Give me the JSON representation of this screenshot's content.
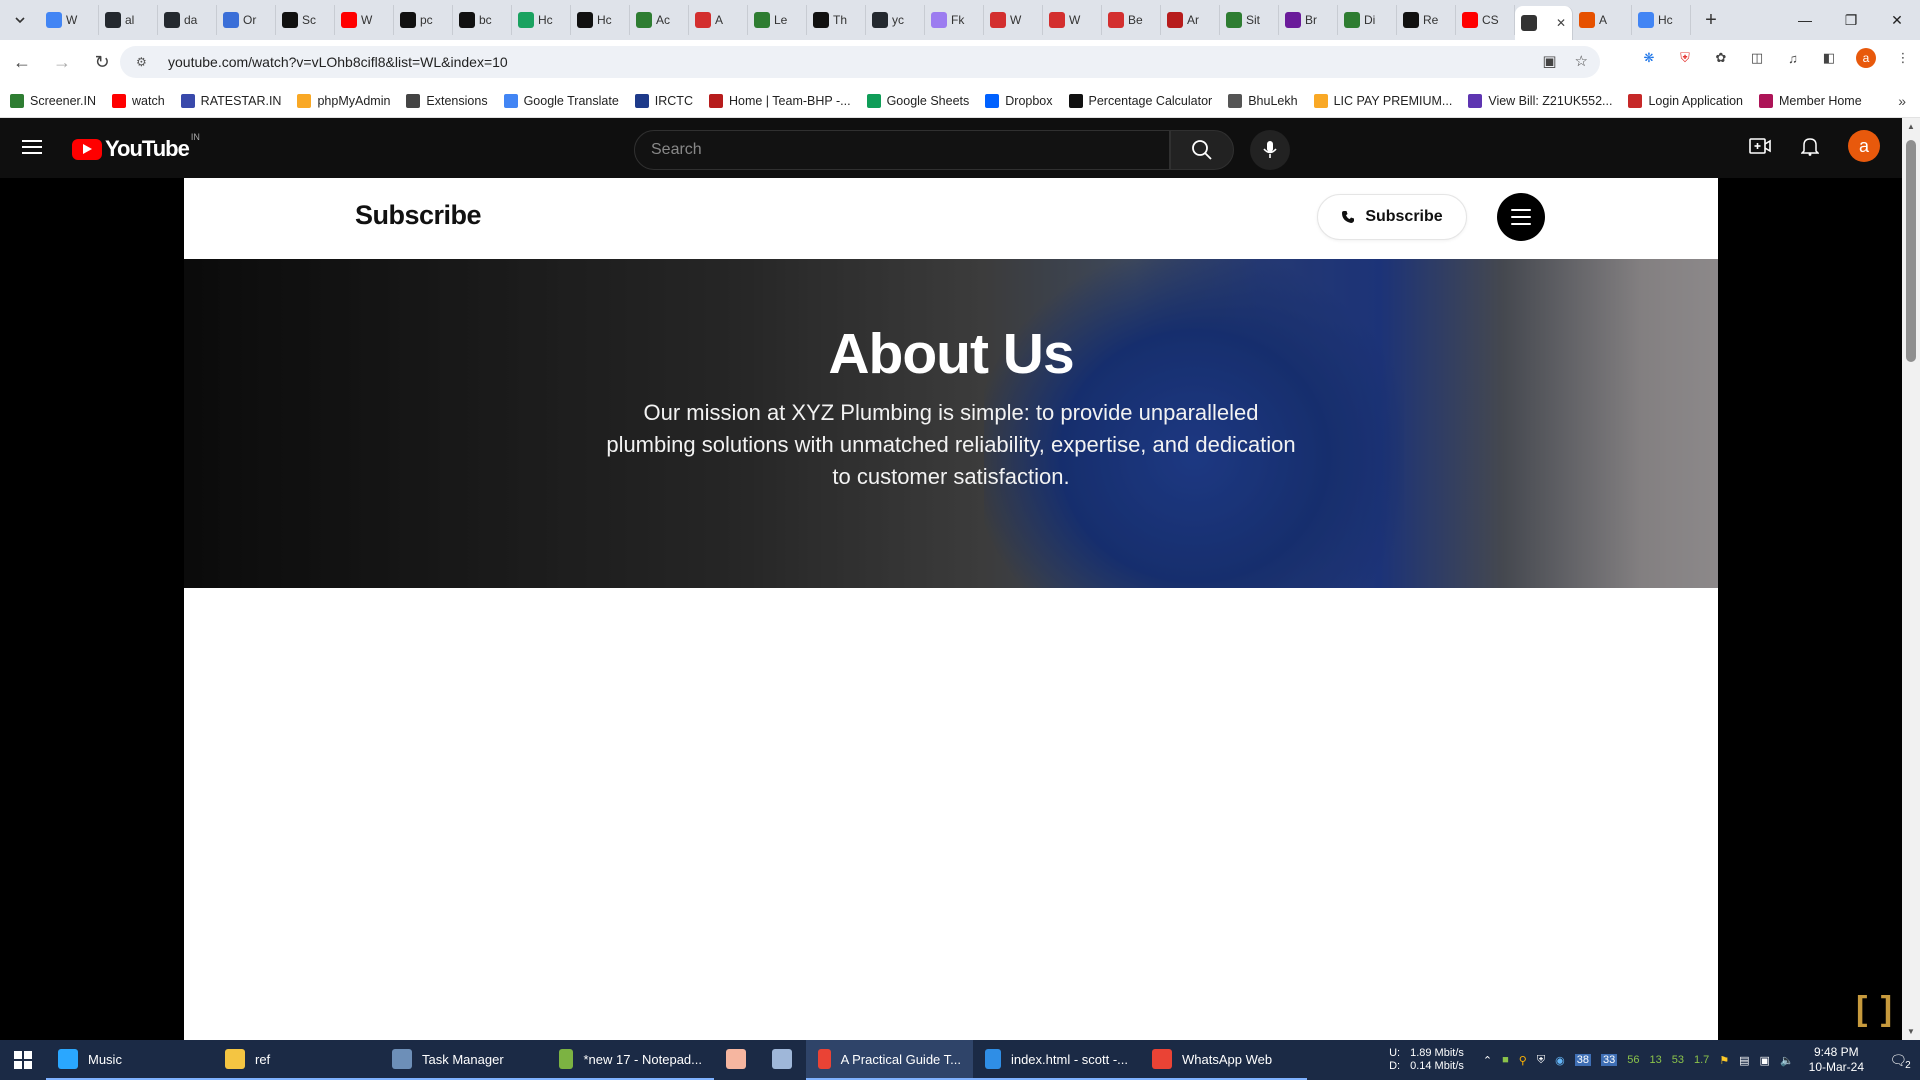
{
  "browser": {
    "tabs": [
      {
        "label": "W",
        "icon": "google-icon",
        "color": "#4285f4"
      },
      {
        "label": "al",
        "icon": "github-icon",
        "color": "#24292f"
      },
      {
        "label": "da",
        "icon": "github-icon",
        "color": "#24292f"
      },
      {
        "label": "Or",
        "icon": "blue-circle-icon",
        "color": "#3b6fd8"
      },
      {
        "label": "Sc",
        "icon": "s-icon",
        "color": "#111111"
      },
      {
        "label": "W",
        "icon": "youtube-icon",
        "color": "#ff0000"
      },
      {
        "label": "pc",
        "icon": "medium-icon",
        "color": "#111111"
      },
      {
        "label": "bc",
        "icon": "medium-icon",
        "color": "#111111"
      },
      {
        "label": "Hc",
        "icon": "w-icon",
        "color": "#1aa260"
      },
      {
        "label": "Hc",
        "icon": "a-icon",
        "color": "#111111"
      },
      {
        "label": "Ac",
        "icon": "infinity-icon",
        "color": "#2e7d32"
      },
      {
        "label": "A",
        "icon": "asterisk-icon",
        "color": "#d32f2f"
      },
      {
        "label": "Le",
        "icon": "leaf-icon",
        "color": "#2e7d32"
      },
      {
        "label": "Th",
        "icon": "dev-icon",
        "color": "#111111"
      },
      {
        "label": "yc",
        "icon": "github-icon",
        "color": "#24292f"
      },
      {
        "label": "Fk",
        "icon": "ring-icon",
        "color": "#9c7cf0"
      },
      {
        "label": "W",
        "icon": "nn-icon",
        "color": "#d32f2f"
      },
      {
        "label": "W",
        "icon": "circle-icon",
        "color": "#d32f2f"
      },
      {
        "label": "Be",
        "icon": "nn-icon",
        "color": "#d32f2f"
      },
      {
        "label": "Ar",
        "icon": "heart-icon",
        "color": "#b71c1c"
      },
      {
        "label": "Sit",
        "icon": "n-icon",
        "color": "#2e7d32"
      },
      {
        "label": "Br",
        "icon": "b-icon",
        "color": "#6a1b9a"
      },
      {
        "label": "Di",
        "icon": "infinity-icon",
        "color": "#2e7d32"
      },
      {
        "label": "Re",
        "icon": "medium-icon",
        "color": "#111111"
      },
      {
        "label": "CS",
        "icon": "youtube-icon",
        "color": "#ff0000"
      },
      {
        "label": "",
        "icon": "speaker-icon",
        "color": "#333333",
        "active": true
      },
      {
        "label": "A",
        "icon": "hand-icon",
        "color": "#e65100"
      },
      {
        "label": "Hc",
        "icon": "google-icon",
        "color": "#4285f4"
      }
    ],
    "url": "youtube.com/watch?v=vLOhb8cifl8&list=WL&index=10",
    "bookmarks": [
      {
        "label": "Screener.IN",
        "color": "#2e7d32"
      },
      {
        "label": "watch",
        "color": "#ff0000"
      },
      {
        "label": "RATESTAR.IN",
        "color": "#3949ab"
      },
      {
        "label": "phpMyAdmin",
        "color": "#f9a825"
      },
      {
        "label": "Extensions",
        "color": "#444444"
      },
      {
        "label": "Google Translate",
        "color": "#4285f4"
      },
      {
        "label": "IRCTC",
        "color": "#1e3a8a"
      },
      {
        "label": "Home | Team-BHP -...",
        "color": "#b71c1c"
      },
      {
        "label": "Google Sheets",
        "color": "#0f9d58"
      },
      {
        "label": "Dropbox",
        "color": "#0061ff"
      },
      {
        "label": "Percentage Calculator",
        "color": "#111111"
      },
      {
        "label": "BhuLekh",
        "color": "#555555"
      },
      {
        "label": "LIC PAY PREMIUM...",
        "color": "#f9a825"
      },
      {
        "label": "View Bill: Z21UK552...",
        "color": "#5e35b1"
      },
      {
        "label": "Login Application",
        "color": "#c62828"
      },
      {
        "label": "Member Home",
        "color": "#ad1457"
      }
    ]
  },
  "youtube": {
    "logo_text": "YouTube",
    "region": "IN",
    "search_placeholder": "Search",
    "avatar_letter": "a"
  },
  "video": {
    "brand": "Subscribe",
    "subscribe_button": "Subscribe",
    "hero_title": "About Us",
    "hero_text": "Our mission at XYZ Plumbing is simple: to provide unparalleled plumbing solutions with unmatched reliability, expertise, and dedication to customer satisfaction.",
    "corner_mark": "[ ]"
  },
  "taskbar": {
    "items": [
      {
        "label": "Music",
        "color": "#2aa7ff"
      },
      {
        "label": "ref",
        "color": "#f4c542"
      },
      {
        "label": "Task Manager",
        "color": "#6d8fb8"
      },
      {
        "label": "*new 17 - Notepad...",
        "color": "#7cb342"
      },
      {
        "label": "",
        "color": "#f6b6a0"
      },
      {
        "label": "",
        "color": "#9fb7d9"
      },
      {
        "label": "A Practical Guide T...",
        "color": "#ea4335",
        "active": true
      },
      {
        "label": "index.html - scott -...",
        "color": "#2f8ee6"
      },
      {
        "label": "WhatsApp Web",
        "color": "#ea4335"
      }
    ],
    "net_up": "U:",
    "net_down": "D:",
    "net_up_val": "1.89 Mbit/s",
    "net_down_val": "0.14 Mbit/s",
    "tray_numbers": [
      "38",
      "33",
      "56",
      "13",
      "53",
      "1.7"
    ],
    "time": "9:48 PM",
    "date": "10-Mar-24",
    "notification_count": "2"
  }
}
